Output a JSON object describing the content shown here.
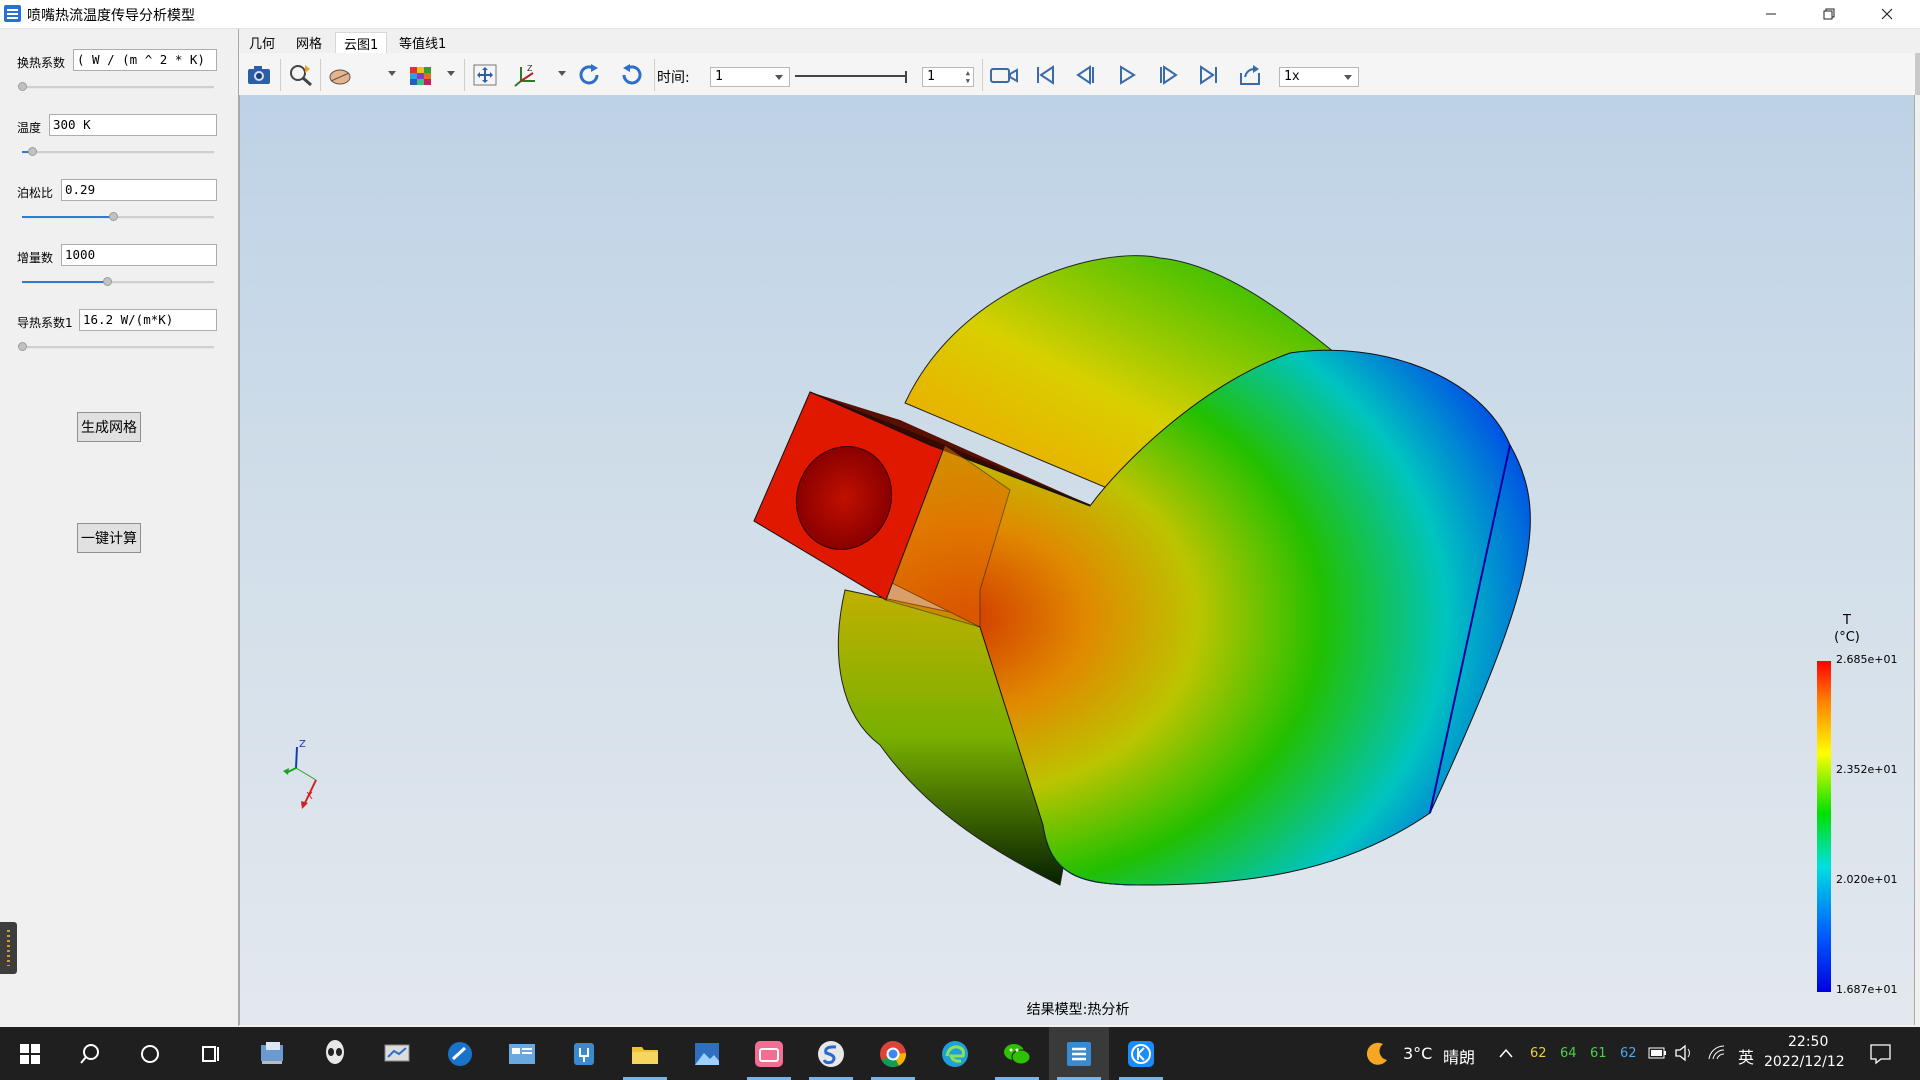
{
  "window": {
    "title": "喷嘴热流温度传导分析模型",
    "icon": "app-icon",
    "controls": [
      "minimize-icon",
      "restore-icon",
      "close-icon"
    ]
  },
  "left_panel": {
    "params": [
      {
        "label": "换热系数",
        "value": "( W / (m ^ 2 * K)",
        "slider": 0.0
      },
      {
        "label": "温度",
        "value": "300 K",
        "slider": 0.05
      },
      {
        "label": "泊松比",
        "value": "0.29",
        "slider": 0.42
      },
      {
        "label": "增量数",
        "value": "1000",
        "slider": 0.4
      },
      {
        "label": "导热系数1",
        "value": "16.2 W/(m*K)",
        "slider": 0.0
      }
    ],
    "buttons": {
      "mesh": "生成网格",
      "compute": "一键计算"
    }
  },
  "menu": {
    "tabs": [
      "几何",
      "网格",
      "云图1",
      "等值线1"
    ],
    "active": "云图1"
  },
  "toolbar": {
    "icons": [
      "camera-icon",
      "zoom-fit-icon",
      "display-mode-icon",
      "color-map-icon",
      "pan-icon",
      "axes-view-icon",
      "rotate-cw-icon",
      "rotate-ccw-icon"
    ],
    "time_label": "时间:",
    "time_value": "1",
    "step_value": "1",
    "playback_icons": [
      "record-icon",
      "first-frame-icon",
      "prev-frame-icon",
      "play-icon",
      "next-frame-icon",
      "last-frame-icon",
      "export-icon"
    ],
    "speed_value": "1x"
  },
  "viewport": {
    "caption": "结果模型:热分析",
    "legend": {
      "title": "T",
      "unit": "(°C)",
      "labels": [
        "2.685e+01",
        "2.352e+01",
        "2.020e+01",
        "1.687e+01"
      ],
      "max_color": "#ff0000",
      "min_color": "#0000e0"
    },
    "triad": {
      "z": "Z",
      "x": "X"
    }
  },
  "taskbar": {
    "apps": [
      "start-icon",
      "search-icon",
      "cortana-icon",
      "task-view-icon",
      "remote-desktop-icon",
      "alien-icon",
      "network-monitor-icon",
      "edge-legacy-icon",
      "control-panel-icon",
      "tool-icon",
      "file-explorer-icon",
      "photos-icon",
      "bilibili-icon",
      "sogou-icon",
      "chrome-icon",
      "edge-icon",
      "wechat-icon",
      "app-active-icon",
      "kugou-icon"
    ],
    "weather_temp": "3°C",
    "weather_desc": "晴朗",
    "cpu_temps": [
      "62",
      "64",
      "61",
      "62"
    ],
    "ime": "英",
    "time": "22:50",
    "date": "2022/12/12"
  }
}
